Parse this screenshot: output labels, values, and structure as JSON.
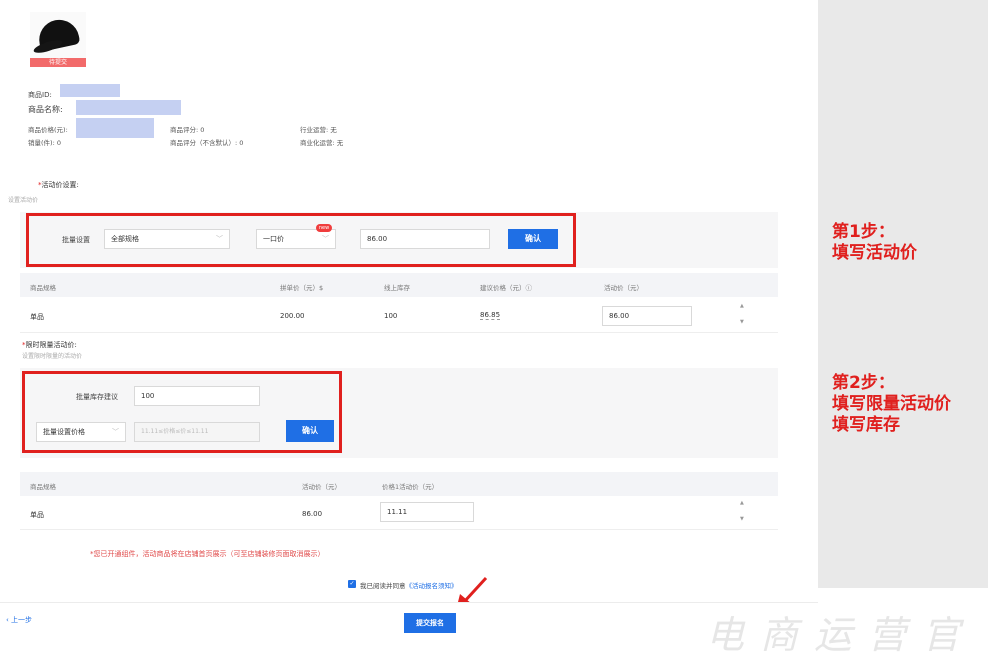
{
  "product": {
    "status_badge": "待提交",
    "id_label": "商品ID:",
    "name_label": "商品名称:",
    "price_label": "商品价格(元):",
    "sales_label": "销量(件): 0",
    "rating": "商品评分: 0",
    "rating_excl": "商品评分（不含默认）: 0",
    "industry_ops": "行业运营: 无",
    "commercial_ops": "商业化运营: 无"
  },
  "activity_price": {
    "title": "活动价设置:",
    "required_mark": "*",
    "subtitle": "设置活动价",
    "batch_label": "批量设置",
    "spec_select": "全部规格",
    "price_type_select": "一口价",
    "new_badge": "new",
    "price_value": "86.00",
    "confirm_label": "确认"
  },
  "price_table": {
    "headers": [
      "商品规格",
      "拼单价（元）$",
      "线上库存",
      "建议价格（元）ⓘ",
      "活动价（元）"
    ],
    "row": {
      "spec": "单品",
      "group_price": "200.00",
      "stock": "100",
      "suggested": "86.85",
      "activity_price": "86.00"
    }
  },
  "limited_price": {
    "title": "限时限量活动价:",
    "required_mark": "*",
    "subtitle": "设置限时限量的活动价",
    "stock_label": "批量库存建议",
    "stock_value": "100",
    "price_select": "批量设置价格",
    "price_placeholder": "11.11≤价格≤价≤11.11",
    "confirm_label": "确认"
  },
  "limited_table": {
    "headers": [
      "商品规格",
      "活动价（元）",
      "价格1活动价（元）"
    ],
    "row": {
      "spec": "单品",
      "activity_price": "86.00",
      "limited_price": "11.11"
    }
  },
  "notice": "*您已开通组件，活动商品将在店铺首页展示（可至店铺装修页面取消展示）",
  "agreement": {
    "text": "我已阅读并同意",
    "link": "《活动报名须知》"
  },
  "footer": {
    "prev": "‹ 上一步",
    "submit": "提交报名"
  },
  "steps": {
    "step1_title": "第1步：",
    "step1_desc": "填写活动价",
    "step2_title": "第2步：",
    "step2_desc1": "填写限量活动价",
    "step2_desc2": "填写库存"
  },
  "watermark": "电商运营官",
  "colors": {
    "accent": "#1f6fe5",
    "annotation_red": "#e0201e"
  }
}
